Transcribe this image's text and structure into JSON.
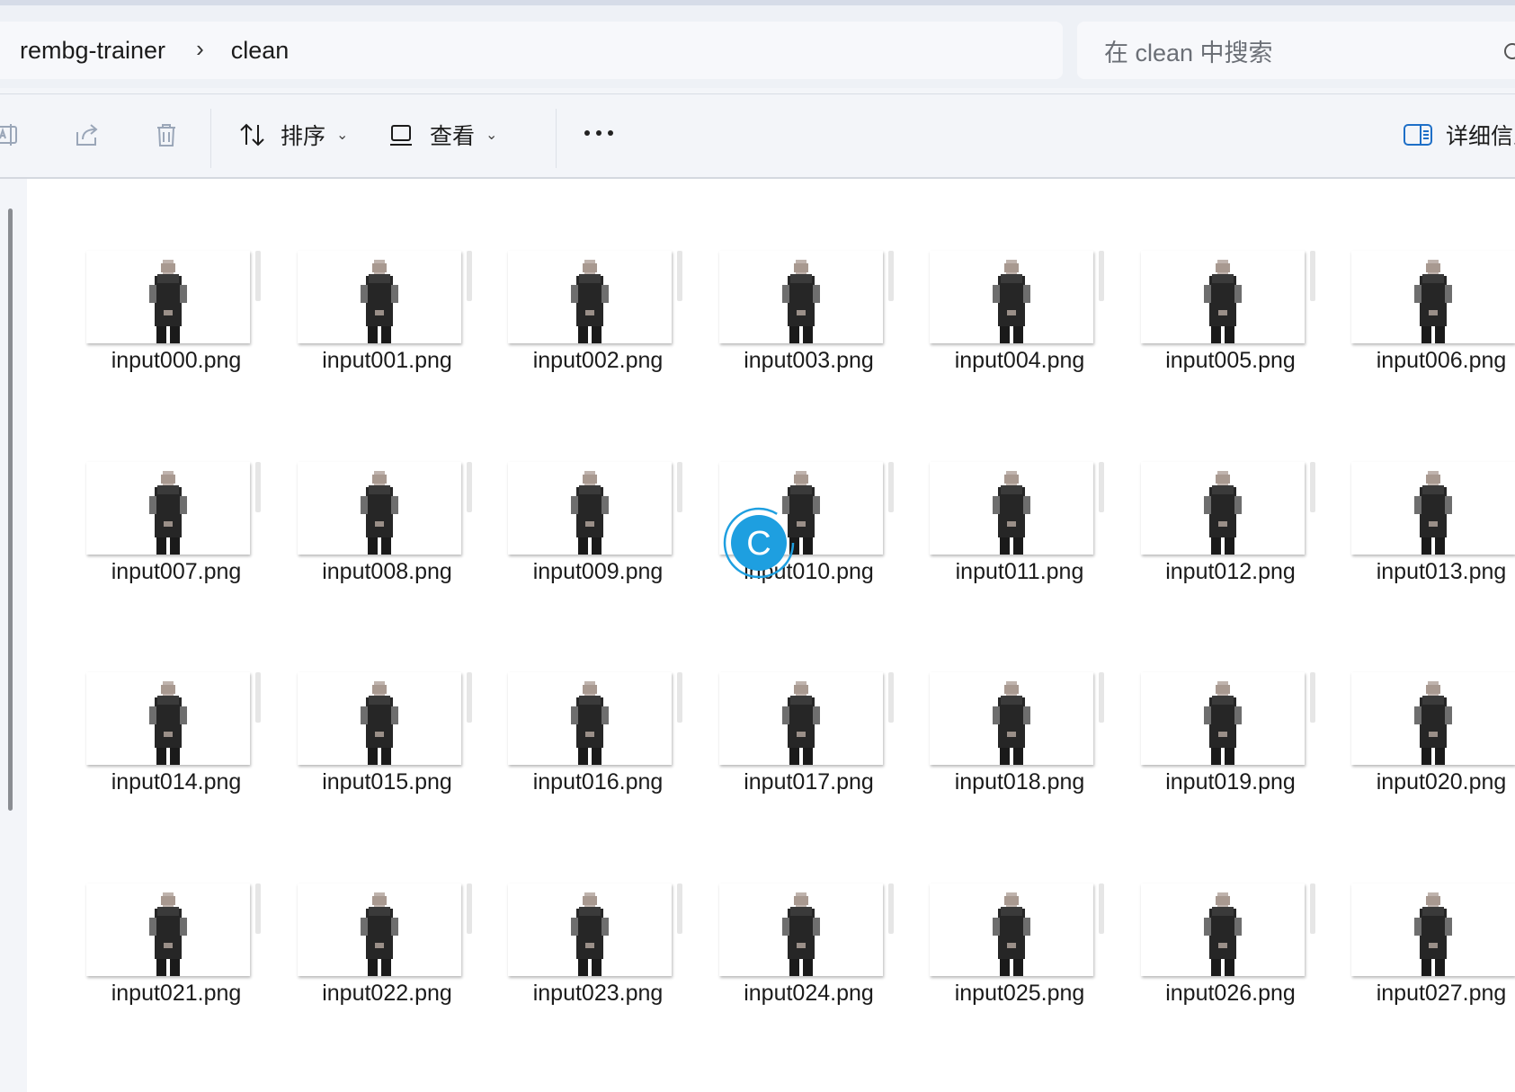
{
  "breadcrumb": {
    "items": [
      "rembg-trainer",
      "clean"
    ],
    "separator": "›"
  },
  "search": {
    "placeholder": "在 clean 中搜索"
  },
  "toolbar": {
    "sort_label": "排序",
    "view_label": "查看",
    "details_label": "详细信息",
    "icons": [
      "rename-icon",
      "share-icon",
      "delete-icon",
      "sort-icon",
      "view-icon",
      "more-icon",
      "details-pane-icon"
    ]
  },
  "files": [
    {
      "name": "input000.png"
    },
    {
      "name": "input001.png"
    },
    {
      "name": "input002.png"
    },
    {
      "name": "input003.png"
    },
    {
      "name": "input004.png"
    },
    {
      "name": "input005.png"
    },
    {
      "name": "input006.png"
    },
    {
      "name": "input007.png"
    },
    {
      "name": "input008.png"
    },
    {
      "name": "input009.png"
    },
    {
      "name": "input010.png"
    },
    {
      "name": "input011.png"
    },
    {
      "name": "input012.png"
    },
    {
      "name": "input013.png"
    },
    {
      "name": "input014.png"
    },
    {
      "name": "input015.png"
    },
    {
      "name": "input016.png"
    },
    {
      "name": "input017.png"
    },
    {
      "name": "input018.png"
    },
    {
      "name": "input019.png"
    },
    {
      "name": "input020.png"
    },
    {
      "name": "input021.png"
    },
    {
      "name": "input022.png"
    },
    {
      "name": "input023.png"
    },
    {
      "name": "input024.png"
    },
    {
      "name": "input025.png"
    },
    {
      "name": "input026.png"
    },
    {
      "name": "input027.png"
    }
  ],
  "cursor": {
    "letter": "C",
    "color": "#1e9fe0"
  },
  "colors": {
    "accent": "#1e9fe0",
    "background": "#f3f5f9",
    "content": "#ffffff"
  }
}
